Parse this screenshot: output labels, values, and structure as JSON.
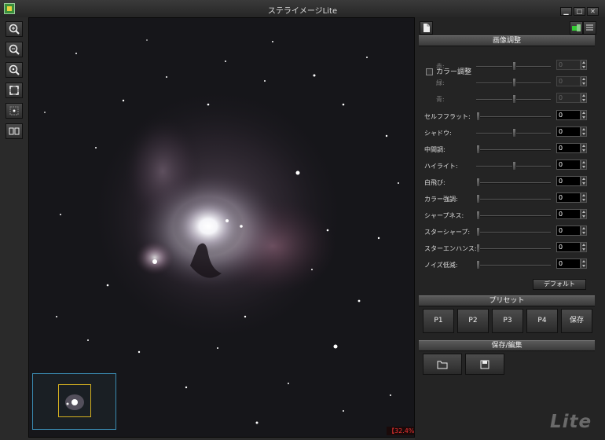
{
  "window": {
    "title": "ステライメージLite",
    "min_label": "▁",
    "max_label": "□",
    "close_label": "✕"
  },
  "toolbar": {
    "tools": [
      {
        "name": "zoom-in-icon"
      },
      {
        "name": "zoom-out-icon"
      },
      {
        "name": "zoom-actual-icon"
      },
      {
        "name": "fit-window-icon"
      },
      {
        "name": "center-icon"
      },
      {
        "name": "compare-icon"
      }
    ]
  },
  "viewer": {
    "zoom_label": "【32.4%】"
  },
  "panel": {
    "image_adjust_title": "画像調整",
    "color_adjust_label": "カラー調整",
    "color_rows": [
      {
        "label": "赤:",
        "value": "0",
        "level": 0.5
      },
      {
        "label": "緑:",
        "value": "0",
        "level": 0.5
      },
      {
        "label": "青:",
        "value": "0",
        "level": 0.5
      }
    ],
    "rows": [
      {
        "label": "セルフフラット:",
        "value": "0",
        "level": 0
      },
      {
        "label": "シャドウ:",
        "value": "0",
        "level": 0.5
      },
      {
        "label": "中間調:",
        "value": "0",
        "level": 0
      },
      {
        "label": "ハイライト:",
        "value": "0",
        "level": 0.5
      },
      {
        "label": "白飛び:",
        "value": "0",
        "level": 0
      },
      {
        "label": "カラー強調:",
        "value": "0",
        "level": 0
      },
      {
        "label": "シャープネス:",
        "value": "0",
        "level": 0
      },
      {
        "label": "スターシャープ:",
        "value": "0",
        "level": 0
      },
      {
        "label": "スターエンハンス:",
        "value": "0",
        "level": 0
      },
      {
        "label": "ノイズ低減:",
        "value": "0",
        "level": 0
      }
    ],
    "default_label": "デフォルト",
    "preset_title": "プリセット",
    "presets": [
      "P1",
      "P2",
      "P3",
      "P4",
      "保存"
    ],
    "save_edit_title": "保存/編集"
  },
  "branding": {
    "lite_mark": "Lite"
  }
}
